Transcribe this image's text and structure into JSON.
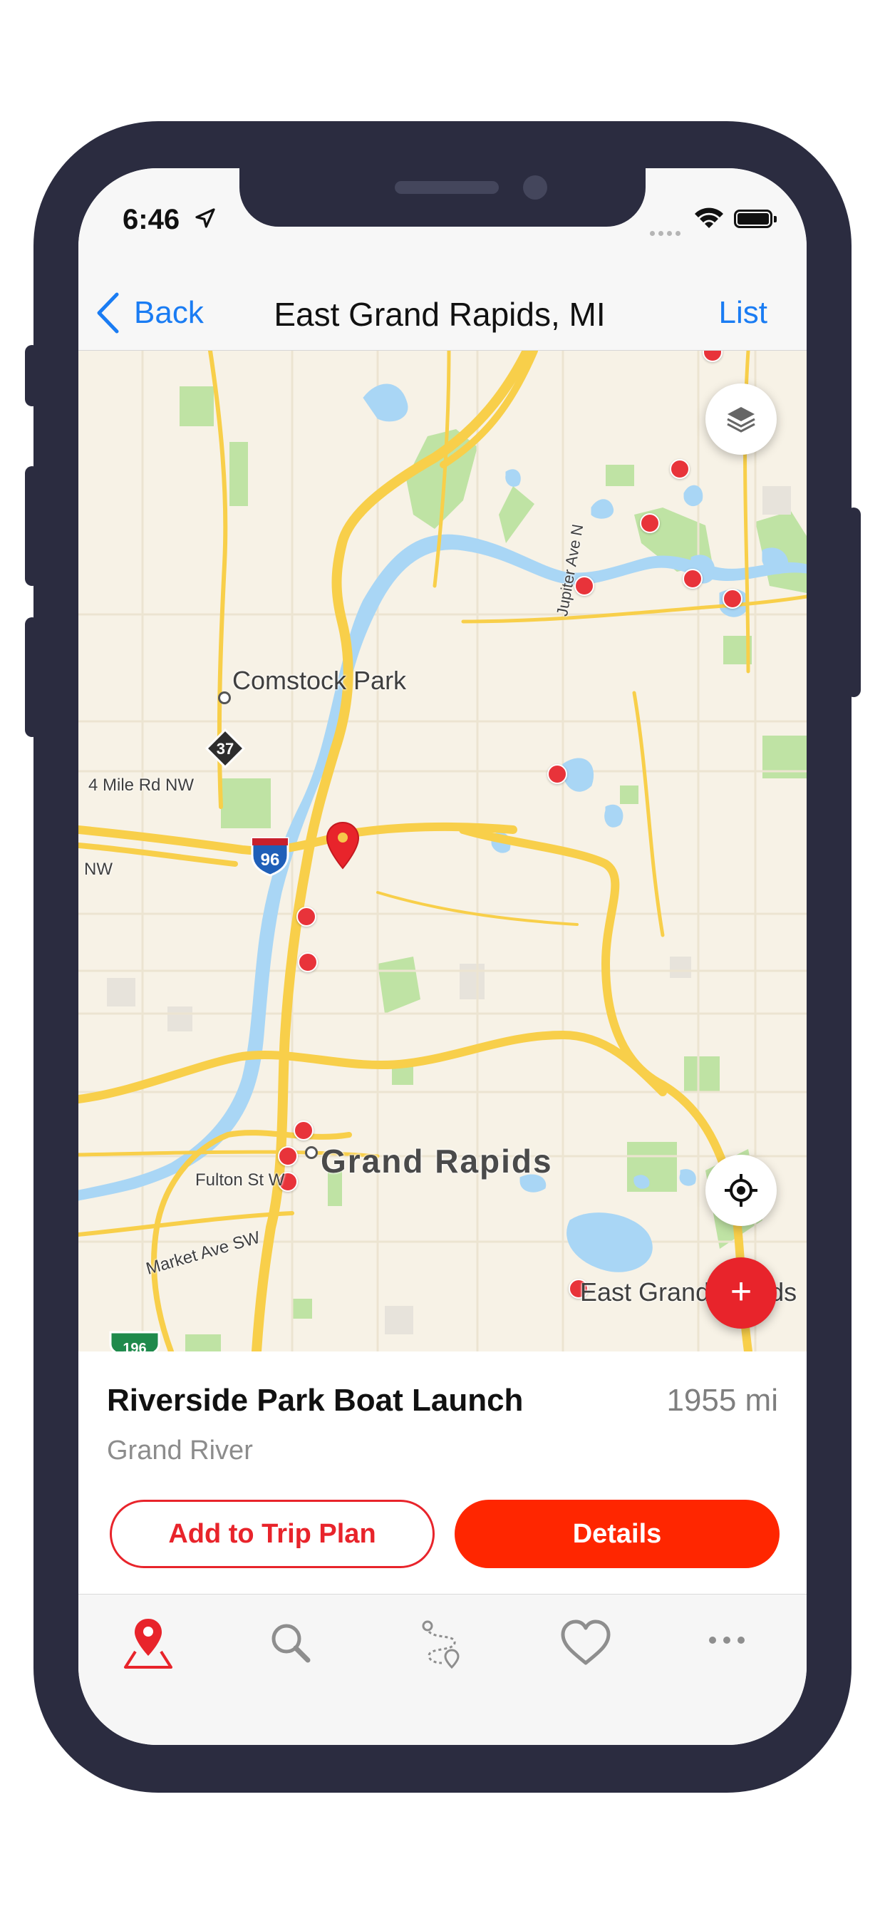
{
  "status_bar": {
    "time": "6:46"
  },
  "nav": {
    "back_label": "Back",
    "title": "East Grand Rapids, MI",
    "list_label": "List"
  },
  "map": {
    "labels": {
      "comstock_park": "Comstock Park",
      "four_mile_rd": "4 Mile Rd NW",
      "nw": "NW",
      "jupiter_ave": "Jupiter Ave N",
      "grand_rapids": "Grand Rapids",
      "fulton_st": "Fulton St W",
      "market_ave": "Market Ave SW",
      "east_grand_rapids": "East Grand Rapids"
    },
    "shields": {
      "m37": "37",
      "i96": "96",
      "i196": "196"
    },
    "water_color": "#a9d6f5",
    "park_color": "#bfe3a4",
    "road_color": "#f8cf4a"
  },
  "card": {
    "title": "Riverside Park Boat Launch",
    "distance": "1955 mi",
    "subtitle": "Grand River",
    "add_button": "Add to Trip Plan",
    "details_button": "Details"
  },
  "tabs": [
    {
      "name": "map",
      "icon": "map-pin-icon",
      "active": true
    },
    {
      "name": "search",
      "icon": "search-icon",
      "active": false
    },
    {
      "name": "trips",
      "icon": "route-icon",
      "active": false
    },
    {
      "name": "favorites",
      "icon": "heart-icon",
      "active": false
    },
    {
      "name": "more",
      "icon": "more-icon",
      "active": false
    }
  ],
  "colors": {
    "accent": "#e8242b",
    "link": "#1a7cf3",
    "details": "#ff2600"
  }
}
